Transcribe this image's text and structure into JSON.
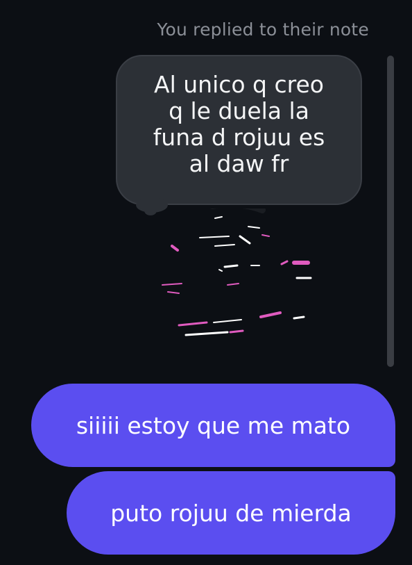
{
  "conversation": {
    "reply_caption": "You replied to their note",
    "note": {
      "lines": [
        "Al unico q creo",
        "q le duela la",
        "funa d rojuu es",
        "al daw fr"
      ]
    },
    "messages": [
      {
        "text": "siiiii estoy que me mato"
      },
      {
        "text": "puto rojuu de mierda"
      }
    ]
  },
  "colors": {
    "background": "#0c0f14",
    "note_bubble": "#2c3036",
    "outgoing_bubble": "#5b4ef0",
    "caption": "#8b8f97",
    "avatar_accent": "#e05bbf"
  },
  "icons": {
    "avatar": "obscured-avatar-icon"
  }
}
